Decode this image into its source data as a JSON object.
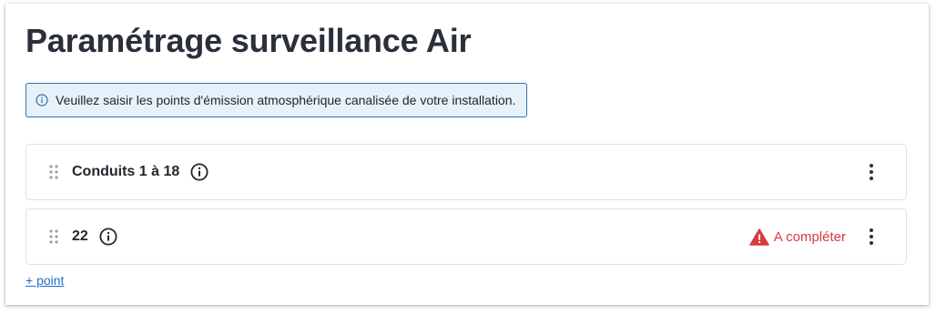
{
  "page": {
    "title": "Paramétrage surveillance Air"
  },
  "alert": {
    "icon": "info-circle-icon",
    "text": "Veuillez saisir les points d'émission atmosphérique canalisée de votre installation.",
    "border_color": "#2f6fb2",
    "background_color": "#e7f1fa"
  },
  "points": [
    {
      "label": "Conduits 1 à 18",
      "status": ""
    },
    {
      "label": "22",
      "status": "A compléter",
      "status_color": "#d43d3d"
    }
  ],
  "actions": {
    "add_point_label": "+ point"
  }
}
